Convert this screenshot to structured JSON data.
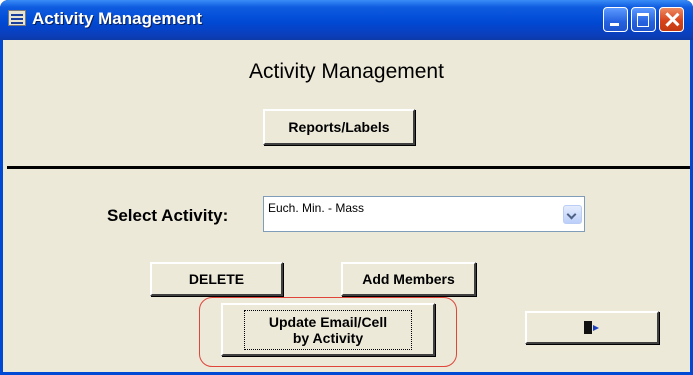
{
  "window": {
    "title": "Activity Management"
  },
  "heading": "Activity Management",
  "buttons": {
    "reports_labels": "Reports/Labels",
    "delete": "DELETE",
    "add_members": "Add Members",
    "update_line1": "Update Email/Cell",
    "update_line2": "by Activity"
  },
  "select_activity": {
    "label": "Select Activity:",
    "value": "Euch. Min. - Mass"
  },
  "icons": {
    "app": "form-icon",
    "minimize": "minimize-icon",
    "maximize": "maximize-icon",
    "close": "close-icon",
    "dropdown": "chevron-down-icon",
    "exit": "exit-door-icon"
  },
  "colors": {
    "titlebar": "#0049d4",
    "client_bg": "#ece9d8",
    "highlight": "#e0453a"
  }
}
